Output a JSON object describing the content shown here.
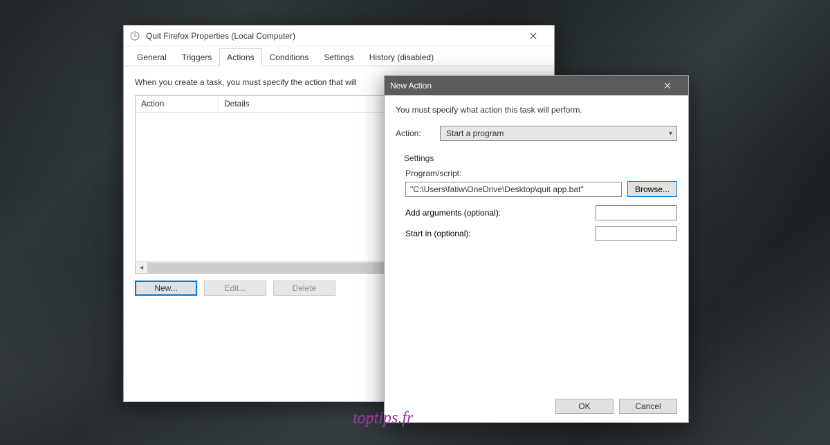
{
  "properties_window": {
    "title": "Quit Firefox Properties (Local Computer)",
    "tabs": [
      "General",
      "Triggers",
      "Actions",
      "Conditions",
      "Settings",
      "History (disabled)"
    ],
    "active_tab_index": 2,
    "instruction": "When you create a task, you must specify the action that will",
    "columns": {
      "action": "Action",
      "details": "Details"
    },
    "buttons": {
      "new": "New...",
      "edit": "Edit...",
      "delete": "Delete"
    }
  },
  "new_action_dialog": {
    "title": "New Action",
    "hint": "You must specify what action this task will perform.",
    "action_label": "Action:",
    "action_value": "Start a program",
    "group_title": "Settings",
    "program_label": "Program/script:",
    "program_value": "\"C:\\Users\\fatiw\\OneDrive\\Desktop\\quit app.bat\"",
    "browse": "Browse...",
    "args_label": "Add arguments (optional):",
    "args_value": "",
    "startin_label": "Start in (optional):",
    "startin_value": "",
    "ok": "OK",
    "cancel": "Cancel"
  },
  "watermark": "toptips.fr"
}
